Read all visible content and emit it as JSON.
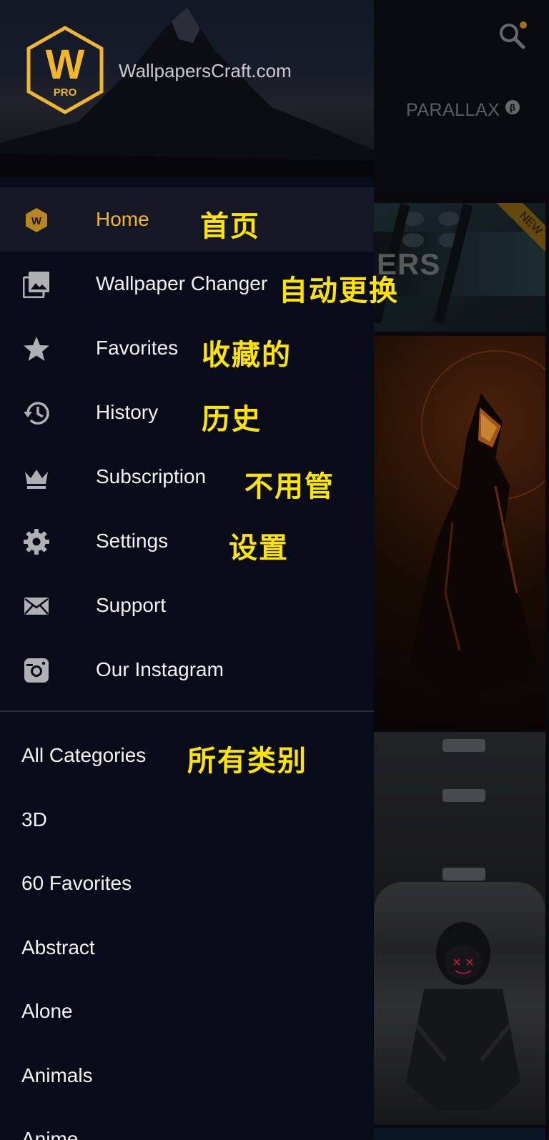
{
  "header": {
    "parallax_label": "PARALLAX",
    "beta_label": "β"
  },
  "promo": {
    "text": "ERS",
    "new_badge": "NEW"
  },
  "drawer": {
    "logo_letter": "W",
    "logo_sub": "PRO",
    "site_name": "WallpapersCraft.com",
    "menu": [
      {
        "label": "Home",
        "icon": "hexagon-w-icon",
        "active": true
      },
      {
        "label": "Wallpaper Changer",
        "icon": "images-icon"
      },
      {
        "label": "Favorites",
        "icon": "star-icon"
      },
      {
        "label": "History",
        "icon": "history-icon"
      },
      {
        "label": "Subscription",
        "icon": "crown-icon"
      },
      {
        "label": "Settings",
        "icon": "gear-icon"
      },
      {
        "label": "Support",
        "icon": "envelope-icon"
      },
      {
        "label": "Our Instagram",
        "icon": "instagram-icon"
      }
    ],
    "categories": [
      "All Categories",
      "3D",
      "60 Favorites",
      "Abstract",
      "Alone",
      "Animals",
      "Anime"
    ]
  },
  "annotations": {
    "home": "首页",
    "wallpaper_changer": "自动更换",
    "favorites": "收藏的",
    "history": "历史",
    "subscription": "不用管",
    "settings": "设置",
    "all_categories": "所有类别"
  },
  "colors": {
    "accent": "#f1b62a",
    "annotation": "#ffe400",
    "drawer_bg": "#080c19"
  }
}
